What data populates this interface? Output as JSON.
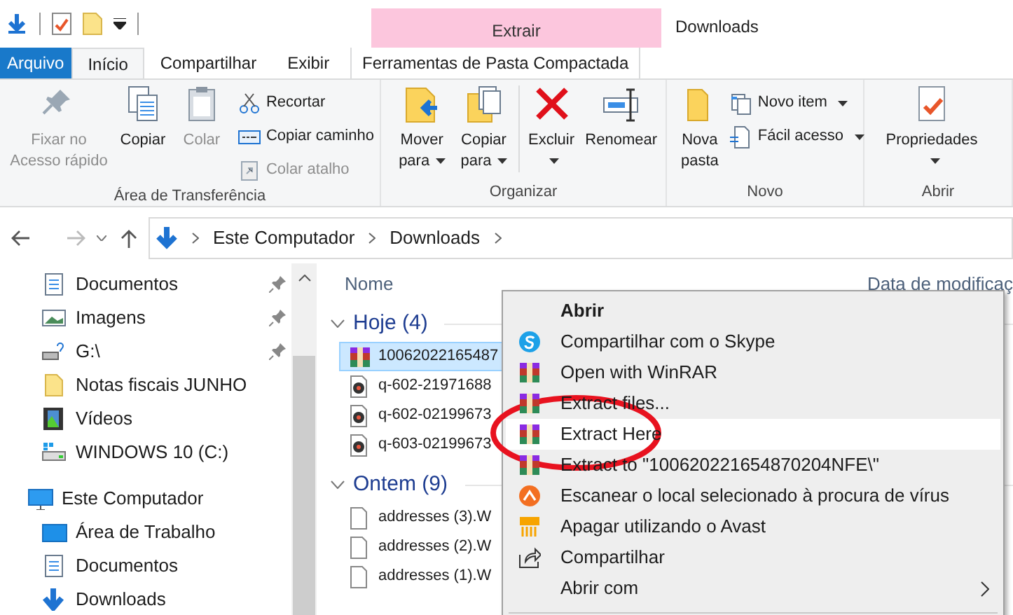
{
  "window": {
    "title": "Downloads"
  },
  "contextual_tab": {
    "header": "Extrair",
    "label": "Ferramentas de Pasta Compactada",
    "selected": false
  },
  "ribbon_tabs": [
    {
      "label": "Arquivo",
      "kind": "file",
      "selected": false
    },
    {
      "label": "Início",
      "kind": "tab",
      "selected": true
    },
    {
      "label": "Compartilhar",
      "kind": "tab",
      "selected": false
    },
    {
      "label": "Exibir",
      "kind": "tab",
      "selected": false
    }
  ],
  "ribbon_groups": [
    {
      "label": "Área de Transferência",
      "large": [
        {
          "label": "Fixar no Acesso rápido",
          "disabled": true,
          "dropdown": false
        },
        {
          "label": "Copiar",
          "disabled": false,
          "dropdown": false
        },
        {
          "label": "Colar",
          "disabled": true,
          "dropdown": false
        }
      ],
      "small": [
        {
          "label": "Recortar",
          "disabled": false,
          "dropdown": false
        },
        {
          "label": "Copiar caminho",
          "disabled": false,
          "dropdown": false
        },
        {
          "label": "Colar atalho",
          "disabled": true,
          "dropdown": false
        }
      ]
    },
    {
      "label": "Organizar",
      "large": [
        {
          "label": "Mover para",
          "disabled": false,
          "dropdown": true
        },
        {
          "label": "Copiar para",
          "disabled": false,
          "dropdown": true
        },
        {
          "label": "Excluir",
          "disabled": false,
          "dropdown": true
        },
        {
          "label": "Renomear",
          "disabled": false,
          "dropdown": false
        }
      ]
    },
    {
      "label": "Novo",
      "large": [
        {
          "label": "Nova pasta",
          "disabled": false,
          "dropdown": false
        }
      ],
      "small": [
        {
          "label": "Novo item",
          "disabled": false,
          "dropdown": true
        },
        {
          "label": "Fácil acesso",
          "disabled": false,
          "dropdown": true
        }
      ]
    },
    {
      "label": "Abrir",
      "large": [
        {
          "label": "Propriedades",
          "disabled": false,
          "dropdown": true
        }
      ]
    }
  ],
  "address": {
    "path": [
      "Este Computador",
      "Downloads"
    ]
  },
  "nav_pane": [
    {
      "label": "Documentos",
      "pinned": true
    },
    {
      "label": "Imagens",
      "pinned": true
    },
    {
      "label": "G:\\",
      "pinned": true
    },
    {
      "label": "Notas fiscais JUNHO",
      "pinned": false
    },
    {
      "label": "Vídeos",
      "pinned": false
    },
    {
      "label": "WINDOWS 10 (C:)",
      "pinned": false
    },
    {
      "label": "Este Computador",
      "pinned": false,
      "children": [
        {
          "label": "Área de Trabalho",
          "pinned": false
        },
        {
          "label": "Documentos",
          "pinned": false
        },
        {
          "label": "Downloads",
          "pinned": false
        }
      ]
    }
  ],
  "columns": [
    "Nome",
    "Data de modificaç"
  ],
  "file_groups": [
    {
      "label": "Hoje (4)",
      "expanded": true,
      "files": [
        {
          "name": "10062022165487",
          "kind": "rar",
          "selected": true
        },
        {
          "name": "q-602-21971688",
          "kind": "media",
          "selected": false
        },
        {
          "name": "q-602-02199673",
          "kind": "media",
          "selected": false
        },
        {
          "name": "q-603-02199673",
          "kind": "media",
          "selected": false
        }
      ]
    },
    {
      "label": "Ontem (9)",
      "expanded": true,
      "files": [
        {
          "name": "addresses (3).W",
          "kind": "blank",
          "selected": false
        },
        {
          "name": "addresses (2).W",
          "kind": "blank",
          "selected": false
        },
        {
          "name": "addresses (1).W",
          "kind": "blank",
          "selected": false
        }
      ]
    }
  ],
  "context_menu": [
    {
      "label": "Abrir",
      "default": true,
      "selected": false,
      "submenu": false
    },
    {
      "label": "Compartilhar com o Skype",
      "default": false,
      "selected": false,
      "submenu": false
    },
    {
      "label": "Open with WinRAR",
      "default": false,
      "selected": false,
      "submenu": false
    },
    {
      "label": "Extract files...",
      "default": false,
      "selected": false,
      "submenu": false
    },
    {
      "label": "Extract Here",
      "default": false,
      "selected": true,
      "submenu": false
    },
    {
      "label": "Extract to \"100620221654870204NFE\\\"",
      "default": false,
      "selected": false,
      "submenu": false
    },
    {
      "label": "Escanear o local selecionado à procura de vírus",
      "default": false,
      "selected": false,
      "submenu": false
    },
    {
      "label": "Apagar utilizando o Avast",
      "default": false,
      "selected": false,
      "submenu": false
    },
    {
      "label": "Compartilhar",
      "default": false,
      "selected": false,
      "submenu": false
    },
    {
      "label": "Abrir com",
      "default": false,
      "selected": false,
      "submenu": true
    }
  ]
}
